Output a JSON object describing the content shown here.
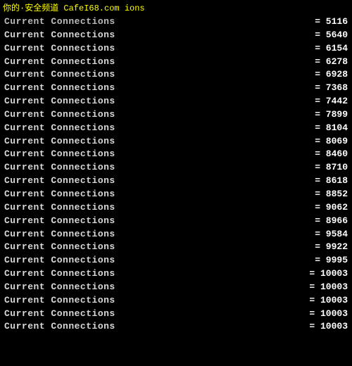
{
  "watermark": {
    "text": "你的·安全频道 CafeI68.com ions"
  },
  "rows": [
    {
      "label": "Current  Connections",
      "value": "= 5116"
    },
    {
      "label": "Current  Connections",
      "value": "= 5640"
    },
    {
      "label": "Current  Connections",
      "value": "= 6154"
    },
    {
      "label": "Current  Connections",
      "value": "= 6278"
    },
    {
      "label": "Current  Connections",
      "value": "= 6928"
    },
    {
      "label": "Current  Connections",
      "value": "= 7368"
    },
    {
      "label": "Current  Connections",
      "value": "= 7442"
    },
    {
      "label": "Current  Connections",
      "value": "= 7899"
    },
    {
      "label": "Current  Connections",
      "value": "= 8104"
    },
    {
      "label": "Current  Connections",
      "value": "= 8069"
    },
    {
      "label": "Current  Connections",
      "value": "= 8460"
    },
    {
      "label": "Current  Connections",
      "value": "= 8710"
    },
    {
      "label": "Current  Connections",
      "value": "= 8618"
    },
    {
      "label": "Current  Connections",
      "value": "= 8852"
    },
    {
      "label": "Current  Connections",
      "value": "= 9062"
    },
    {
      "label": "Current  Connections",
      "value": "= 8966"
    },
    {
      "label": "Current  Connections",
      "value": "= 9584"
    },
    {
      "label": "Current  Connections",
      "value": "= 9922"
    },
    {
      "label": "Current  Connections",
      "value": "= 9995"
    },
    {
      "label": "Current  Connections",
      "value": "= 10003"
    },
    {
      "label": "Current  Connections",
      "value": "= 10003"
    },
    {
      "label": "Current  Connections",
      "value": "= 10003"
    },
    {
      "label": "Current  Connections",
      "value": "= 10003"
    },
    {
      "label": "Current  Connections",
      "value": "= 10003"
    }
  ]
}
